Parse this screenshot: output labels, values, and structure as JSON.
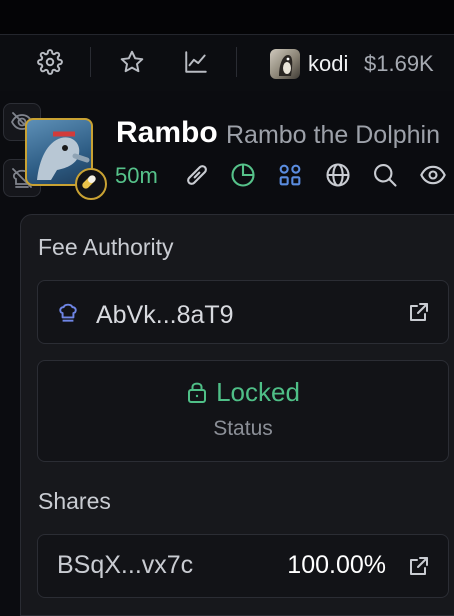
{
  "header": {
    "user": {
      "name": "kodi",
      "balance": "$1.69K"
    },
    "icons": [
      "settings-gear-icon",
      "star-icon",
      "chart-line-icon"
    ]
  },
  "token": {
    "ticker": "Rambo",
    "name": "Rambo the Dolphin",
    "age": "50m",
    "icons": [
      "link-icon",
      "pie-chart-icon",
      "apps-icon",
      "globe-icon",
      "search-icon",
      "eye-icon"
    ]
  },
  "panel": {
    "fee_authority_label": "Fee Authority",
    "fee_authority_address": "AbVk...8aT9",
    "lock_status": "Locked",
    "status_label": "Status",
    "shares_label": "Shares",
    "shares": [
      {
        "address": "BSqX...vx7c",
        "percent": "100.00%"
      }
    ]
  },
  "colors": {
    "accent_green": "#56c28a",
    "gold_border": "#c9a233",
    "blue_icon": "#5b8de0"
  }
}
